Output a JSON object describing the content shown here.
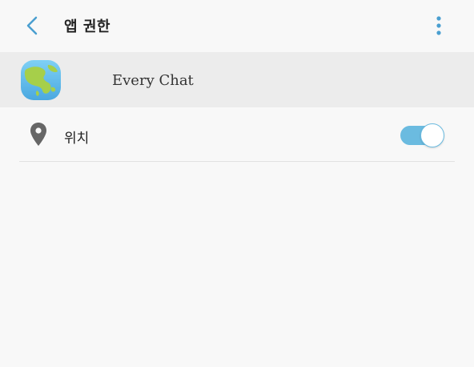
{
  "header": {
    "title": "앱 권한",
    "back_icon": "chevron-left-icon",
    "more_icon": "more-vert-icon",
    "accent_color": "#4a9fd0"
  },
  "app": {
    "name": "Every Chat",
    "icon": "globe-app-icon"
  },
  "permissions": [
    {
      "label": "위치",
      "icon": "location-pin-icon",
      "enabled": true,
      "toggle_color": "#6bbbe0"
    }
  ]
}
